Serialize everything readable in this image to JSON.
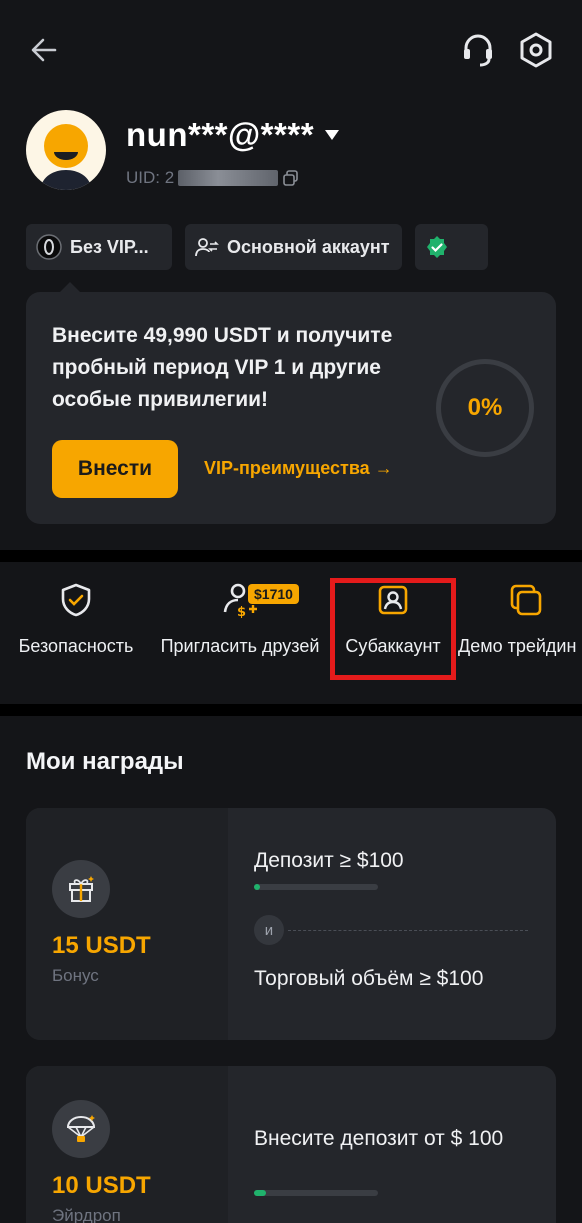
{
  "profile": {
    "username": "nun***@****",
    "uid_label": "UID: 2"
  },
  "chips": {
    "vip": "Без VIP...",
    "account": "Основной аккаунт"
  },
  "vip_card": {
    "text": "Внесите 49,990 USDT и получите пробный период VIP 1 и другие особые привилегии!",
    "deposit_button": "Внести",
    "benefits_link": "VIP-преимущества",
    "progress": "0%"
  },
  "quick_actions": [
    {
      "label": "Безопасность",
      "icon": "shield-check-icon"
    },
    {
      "label": "Пригласить друзей",
      "icon": "invite-user-icon",
      "badge": "$1710"
    },
    {
      "label": "Субаккаунт",
      "icon": "subaccount-icon"
    },
    {
      "label": "Демо трейдин",
      "icon": "demo-trading-icon"
    }
  ],
  "rewards": {
    "title": "Мои награды",
    "items": [
      {
        "icon": "gift-icon",
        "amount": "15 USDT",
        "kind": "Бонус",
        "condition1": "Депозит ≥ $100",
        "and_label": "и",
        "condition2": "Торговый объём ≥ $100",
        "progress": 0.05
      },
      {
        "icon": "parachute-icon",
        "amount": "10 USDT",
        "kind": "Эйрдроп",
        "condition1": "Внесите депозит от $ 100",
        "progress": 0.1
      }
    ]
  },
  "colors": {
    "background": "#141518",
    "card": "#24262b",
    "accent": "#f7a600",
    "highlight": "#e51b1b",
    "progress": "#20b26c"
  }
}
